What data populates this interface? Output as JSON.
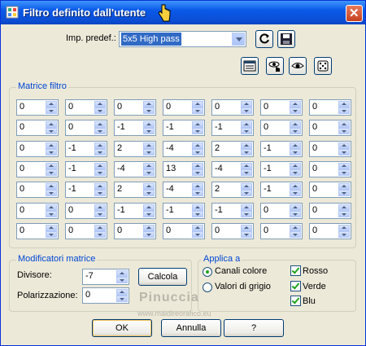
{
  "title": "Filtro definito dall'utente",
  "preset": {
    "label": "Imp. predef.:",
    "value": "5x5 High pass"
  },
  "matrix_group": {
    "title": "Matrice filtro",
    "rows": [
      [
        "0",
        "0",
        "0",
        "0",
        "0",
        "0",
        "0"
      ],
      [
        "0",
        "0",
        "-1",
        "-1",
        "-1",
        "0",
        "0"
      ],
      [
        "0",
        "-1",
        "2",
        "-4",
        "2",
        "-1",
        "0"
      ],
      [
        "0",
        "-1",
        "-4",
        "13",
        "-4",
        "-1",
        "0"
      ],
      [
        "0",
        "-1",
        "2",
        "-4",
        "2",
        "-1",
        "0"
      ],
      [
        "0",
        "0",
        "-1",
        "-1",
        "-1",
        "0",
        "0"
      ],
      [
        "0",
        "0",
        "0",
        "0",
        "0",
        "0",
        "0"
      ]
    ]
  },
  "modifiers": {
    "title": "Modificatori matrice",
    "divisor_label": "Divisore:",
    "divisor_value": "-7",
    "bias_label": "Polarizzazione:",
    "bias_value": "0",
    "calc_button": "Calcola"
  },
  "apply_to": {
    "title": "Applica a",
    "radio_color": "Canali colore",
    "radio_gray": "Valori di grigio",
    "check_red": "Rosso",
    "check_green": "Verde",
    "check_blue": "Blu"
  },
  "buttons": {
    "ok": "OK",
    "cancel": "Annulla",
    "help": "?"
  },
  "watermark": {
    "name": "Pinuccia",
    "site": "www.maidireorafico.eu"
  },
  "colors": {
    "titlebar": "#0a5ae8",
    "group_title": "#0046d5",
    "selection": "#316ac5"
  }
}
